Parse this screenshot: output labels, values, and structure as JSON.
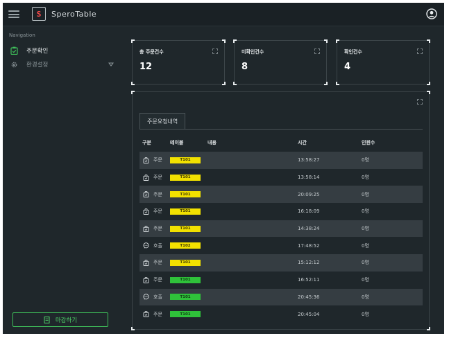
{
  "app": {
    "title": "SperoTable",
    "logo_letter": "S"
  },
  "sidebar": {
    "nav_title": "Navigation",
    "items": [
      {
        "label": "주문확인",
        "icon": "clipboard-check-icon",
        "active": true
      },
      {
        "label": "환경설정",
        "icon": "gear-icon",
        "active": false
      }
    ],
    "close_button": "마감하기"
  },
  "stats": [
    {
      "label": "총 주문건수",
      "value": "12"
    },
    {
      "label": "미확인건수",
      "value": "8"
    },
    {
      "label": "확인건수",
      "value": "4"
    }
  ],
  "orders": {
    "tab_label": "주문요청내역",
    "columns": [
      "구분",
      "테이블",
      "내용",
      "시간",
      "인원수"
    ],
    "rows": [
      {
        "type": "주문",
        "type_icon": "bag-icon",
        "table": "T101",
        "status": "yellow",
        "time": "13:58:27",
        "people": "0명"
      },
      {
        "type": "주문",
        "type_icon": "bag-icon",
        "table": "T101",
        "status": "yellow",
        "time": "13:58:14",
        "people": "0명"
      },
      {
        "type": "주문",
        "type_icon": "bag-icon",
        "table": "T101",
        "status": "yellow",
        "time": "20:09:25",
        "people": "0명"
      },
      {
        "type": "주문",
        "type_icon": "bag-icon",
        "table": "T101",
        "status": "yellow",
        "time": "16:18:09",
        "people": "0명"
      },
      {
        "type": "주문",
        "type_icon": "bag-icon",
        "table": "T101",
        "status": "yellow",
        "time": "14:38:24",
        "people": "0명"
      },
      {
        "type": "호출",
        "type_icon": "chat-icon",
        "table": "T102",
        "status": "yellow",
        "time": "17:48:52",
        "people": "0명"
      },
      {
        "type": "주문",
        "type_icon": "bag-icon",
        "table": "T101",
        "status": "yellow",
        "time": "15:12:12",
        "people": "0명"
      },
      {
        "type": "주문",
        "type_icon": "bag-icon",
        "table": "T101",
        "status": "green",
        "time": "16:52:11",
        "people": "0명"
      },
      {
        "type": "호출",
        "type_icon": "chat-icon",
        "table": "T101",
        "status": "green",
        "time": "20:45:36",
        "people": "0명"
      },
      {
        "type": "주문",
        "type_icon": "bag-icon",
        "table": "T101",
        "status": "green",
        "time": "20:45:04",
        "people": "0명"
      }
    ]
  },
  "colors": {
    "background": "#1f272b",
    "accent_green": "#3fbf5a",
    "badge_yellow": "#f2e100",
    "badge_green": "#2fc23a",
    "logo_red": "#ff4a4a"
  }
}
